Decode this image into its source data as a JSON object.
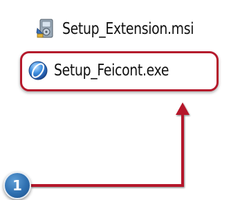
{
  "files": [
    {
      "name": "Setup_Extension.msi",
      "icon": "msi-installer-icon"
    },
    {
      "name": "Setup_Feicont.exe",
      "icon": "blue-globe-app-icon"
    }
  ],
  "callout": {
    "step_number": "1",
    "highlight_color": "#b5182b",
    "badge_color": "#2e6fb0"
  }
}
